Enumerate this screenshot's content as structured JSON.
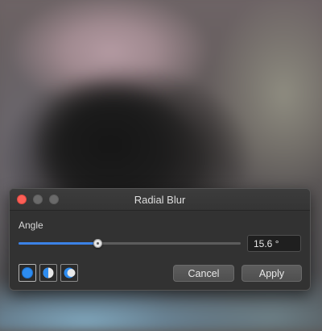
{
  "window": {
    "title": "Radial Blur"
  },
  "angle": {
    "label": "Angle",
    "value_text": "15.6 °",
    "slider_fraction": 0.355
  },
  "modes": [
    {
      "name": "full-circle-mode",
      "icon": "filled-circle-icon",
      "selected": true
    },
    {
      "name": "half-circle-mode",
      "icon": "half-circle-icon",
      "selected": false
    },
    {
      "name": "crescent-mode",
      "icon": "crescent-icon",
      "selected": false
    }
  ],
  "buttons": {
    "cancel_label": "Cancel",
    "apply_label": "Apply"
  },
  "colors": {
    "accent": "#3b82e6",
    "close": "#fc5f57",
    "dialog_bg": "#323232"
  }
}
